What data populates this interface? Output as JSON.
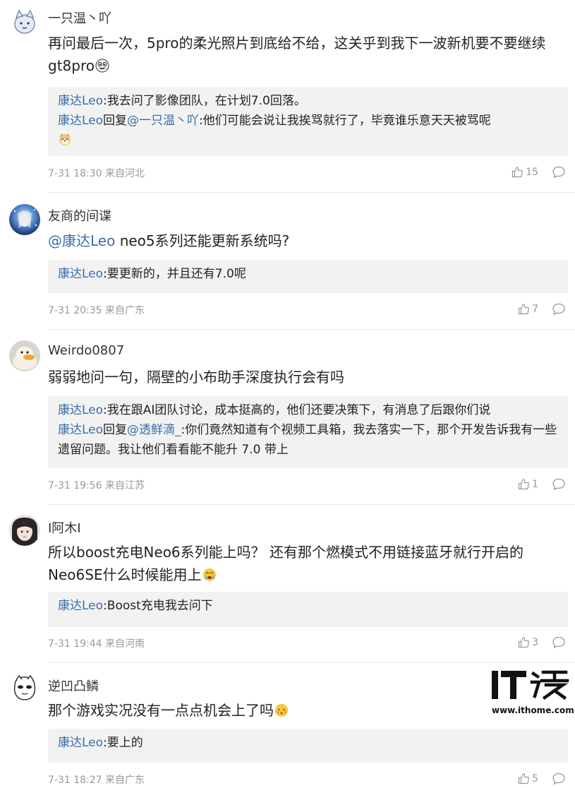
{
  "comments": [
    {
      "username": "一只温丶吖",
      "content": "再问最后一次，5pro的柔光照片到底给不给，这关乎到我下一波新机要不要继续gt8pro",
      "replies": [
        {
          "name": "康达Leo",
          "sep": ":",
          "text": "我去问了影像团队，在计划7.0回落。"
        },
        {
          "name": "康达Leo",
          "mid": "回复",
          "mention": "@一只温丶吖",
          "sep": ":",
          "text": "他们可能会说让我挨骂就行了，毕竟谁乐意天天被骂呢"
        }
      ],
      "time": "7-31 18:30",
      "source": "来自河北",
      "likes": "15"
    },
    {
      "username": "友商的间谍",
      "mention": "@康达Leo",
      "content": " neo5系列还能更新系统吗?",
      "replies": [
        {
          "name": "康达Leo",
          "sep": ":",
          "text": "要更新的，并且还有7.0呢"
        }
      ],
      "time": "7-31 20:35",
      "source": "来自广东",
      "likes": "7"
    },
    {
      "username": "Weirdo0807",
      "content": "弱弱地问一句，隔壁的小布助手深度执行会有吗",
      "replies": [
        {
          "name": "康达Leo",
          "sep": ":",
          "text": "我在跟AI团队讨论，成本挺高的，他们还要决策下，有消息了后跟你们说"
        },
        {
          "name": "康达Leo",
          "mid": "回复",
          "mention": "@透鲜滴_",
          "sep": ":",
          "text": "你们竟然知道有个视频工具箱，我去落实一下，那个开发告诉我有一些遗留问题。我让他们看看能不能升 7.0 带上"
        }
      ],
      "time": "7-31 19:56",
      "source": "来自江苏",
      "likes": "1"
    },
    {
      "username": "I阿木I",
      "content": "所以boost充电Neo6系列能上吗？ 还有那个燃模式不用链接蓝牙就行开启的Neo6SE什么时候能用上",
      "replies": [
        {
          "name": "康达Leo",
          "sep": ":",
          "text": "Boost充电我去问下"
        }
      ],
      "time": "7-31 19:44",
      "source": "来自河南",
      "likes": "3"
    },
    {
      "username": "逆凹凸鳞",
      "content": "那个游戏实况没有一点点机会上了吗",
      "replies": [
        {
          "name": "康达Leo",
          "sep": ":",
          "text": "要上的"
        }
      ],
      "time": "7-31 18:27",
      "source": "来自广东",
      "likes": "5"
    }
  ],
  "watermark": {
    "logo": "IT之家",
    "url": "www.ithome.com"
  },
  "colors": {
    "link": "#3a6fa8",
    "meta": "#999999",
    "reply_bg": "#f2f2f2"
  },
  "icons": [
    "thumb-up-icon",
    "reply-bubble-icon",
    "grin-emoji",
    "dog-emoji",
    "crying-emoji",
    "shy-emoji"
  ]
}
